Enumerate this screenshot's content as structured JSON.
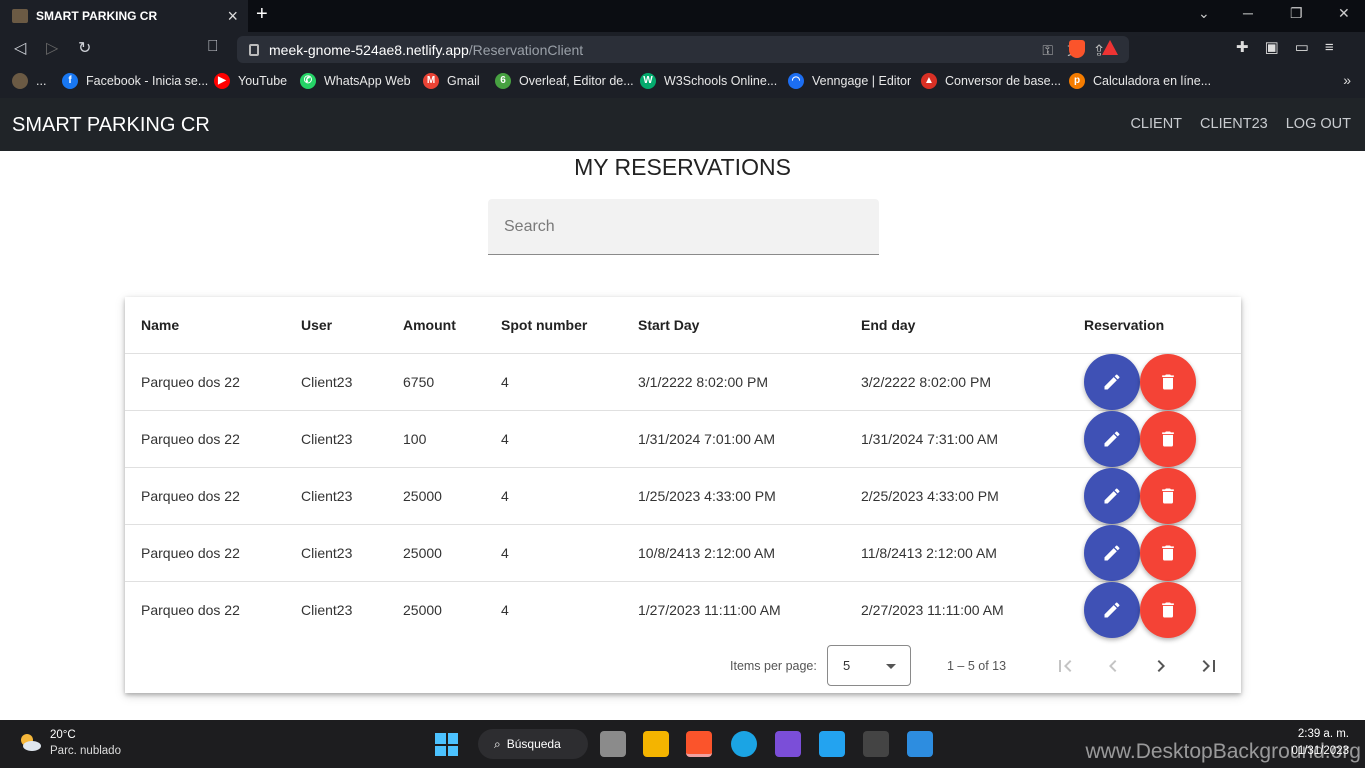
{
  "browser": {
    "tab_title": "SMART PARKING CR",
    "url_domain": "meek-gnome-524ae8.netlify.app",
    "url_path": "/ReservationClient",
    "bookmarks": [
      {
        "label": "...",
        "color": "#6b5a44",
        "glyph": ""
      },
      {
        "label": "Facebook - Inicia se...",
        "color": "#1877f2",
        "glyph": "f"
      },
      {
        "label": "YouTube",
        "color": "#ff0000",
        "glyph": "▶"
      },
      {
        "label": "WhatsApp Web",
        "color": "#25d366",
        "glyph": "✆"
      },
      {
        "label": "Gmail",
        "color": "#ea4335",
        "glyph": "M"
      },
      {
        "label": "Overleaf, Editor de...",
        "color": "#47a141",
        "glyph": "6"
      },
      {
        "label": "W3Schools Online...",
        "color": "#04aa6d",
        "glyph": "W"
      },
      {
        "label": "Venngage | Editor",
        "color": "#1c6ef2",
        "glyph": "◠"
      },
      {
        "label": "Conversor de base...",
        "color": "#d93025",
        "glyph": "▲"
      },
      {
        "label": "Calculadora en líne...",
        "color": "#f57c00",
        "glyph": "p"
      }
    ]
  },
  "app": {
    "brand": "SMART PARKING CR",
    "nav": [
      "CLIENT",
      "CLIENT23",
      "LOG OUT"
    ],
    "page_title": "MY RESERVATIONS",
    "search_placeholder": "Search",
    "table": {
      "headers": [
        "Name",
        "User",
        "Amount",
        "Spot number",
        "Start Day",
        "End day",
        "Reservation"
      ],
      "rows": [
        [
          "Parqueo dos 22",
          "Client23",
          "6750",
          "4",
          "3/1/2222 8:02:00 PM",
          "3/2/2222 8:02:00 PM"
        ],
        [
          "Parqueo dos 22",
          "Client23",
          "100",
          "4",
          "1/31/2024 7:01:00 AM",
          "1/31/2024 7:31:00 AM"
        ],
        [
          "Parqueo dos 22",
          "Client23",
          "25000",
          "4",
          "1/25/2023 4:33:00 PM",
          "2/25/2023 4:33:00 PM"
        ],
        [
          "Parqueo dos 22",
          "Client23",
          "25000",
          "4",
          "10/8/2413 2:12:00 AM",
          "11/8/2413 2:12:00 AM"
        ],
        [
          "Parqueo dos 22",
          "Client23",
          "25000",
          "4",
          "1/27/2023 11:11:00 AM",
          "2/27/2023 11:11:00 AM"
        ]
      ]
    },
    "paginator": {
      "items_per_page_label": "Items per page:",
      "page_size": "5",
      "range": "1 – 5 of 13"
    },
    "colors": {
      "edit": "#3f51b5",
      "delete": "#f44336",
      "appbar": "#202428"
    }
  },
  "taskbar": {
    "temperature": "20°C",
    "condition": "Parc. nublado",
    "search_label": "Búsqueda",
    "time": "2:39 a. m.",
    "date": "01/31/2023"
  },
  "watermark": "www.DesktopBackground.org"
}
